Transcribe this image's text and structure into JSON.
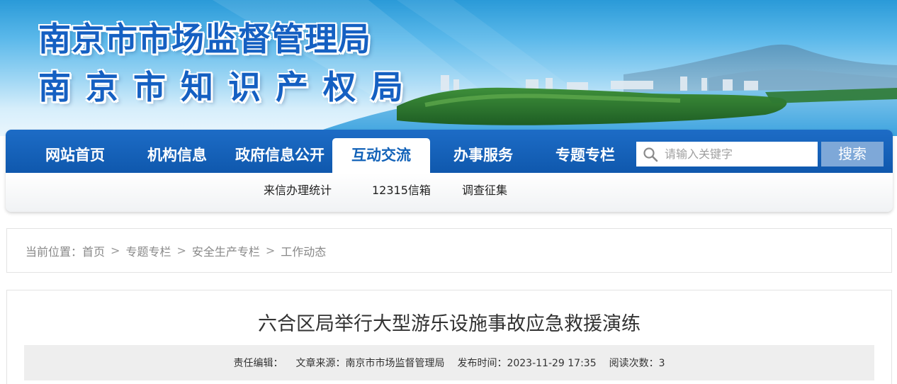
{
  "banner": {
    "title_line1": "南京市市场监督管理局",
    "title_line2": "南京市知识产权局"
  },
  "nav": {
    "items": [
      {
        "label": "网站首页"
      },
      {
        "label": "机构信息"
      },
      {
        "label": "政府信息公开"
      },
      {
        "label": "互动交流",
        "active": true
      },
      {
        "label": "办事服务"
      },
      {
        "label": "专题专栏"
      }
    ],
    "subitems": [
      {
        "label": "来信办理统计"
      },
      {
        "label": "12315信箱"
      },
      {
        "label": "调查征集"
      }
    ]
  },
  "search": {
    "placeholder": "请输入关键字",
    "button_label": "搜索",
    "icon": "search-icon"
  },
  "breadcrumb": {
    "prefix": "当前位置：",
    "items": [
      "首页",
      "专题专栏",
      "安全生产专栏",
      "工作动态"
    ],
    "separator": ">"
  },
  "article": {
    "title": "六合区局举行大型游乐设施事故应急救援演练",
    "meta": {
      "editor": "责任编辑：",
      "source": "文章来源：南京市市场监督管理局",
      "published": "发布时间：2023-11-29 17:35",
      "views": "阅读次数：3"
    }
  },
  "colors": {
    "nav_bg": "#1462b8",
    "active_tab_text": "#1262b8",
    "banner_title": "#1560c2",
    "search_button": "#7ea8d8"
  }
}
